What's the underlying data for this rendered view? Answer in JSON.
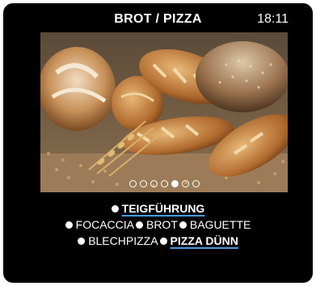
{
  "header": {
    "title": "BROT / PIZZA",
    "time": "18:11"
  },
  "carousel": {
    "dot_count": 7,
    "active_index": 4
  },
  "menu": {
    "rows": [
      [
        {
          "label": "TEIGFÜHRUNG",
          "selected": true
        }
      ],
      [
        {
          "label": "FOCACCIA",
          "selected": false
        },
        {
          "label": "BROT",
          "selected": false
        },
        {
          "label": "BAGUETTE",
          "selected": false
        }
      ],
      [
        {
          "label": "BLECHPIZZA",
          "selected": false
        },
        {
          "label": "PIZZA DÜNN",
          "selected": true
        }
      ]
    ]
  }
}
